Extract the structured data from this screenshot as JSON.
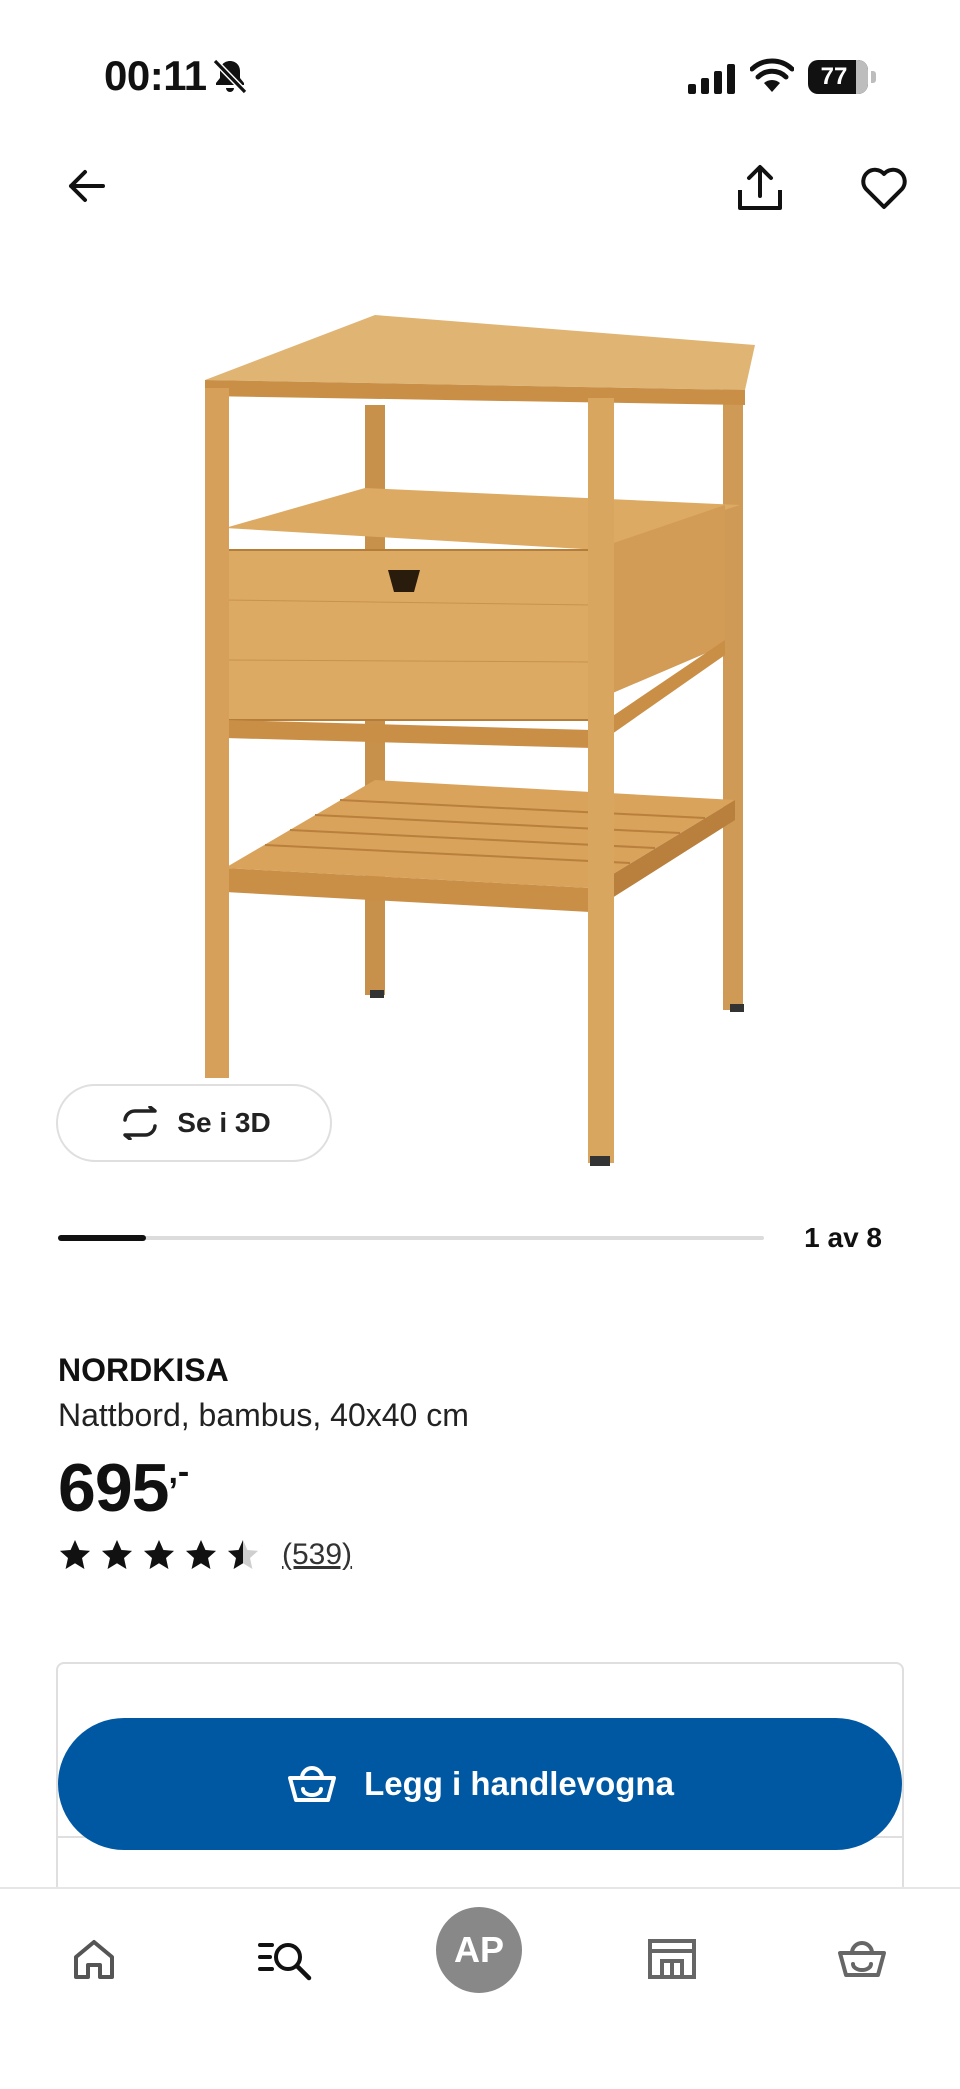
{
  "status_bar": {
    "time": "00:11",
    "battery": "77",
    "icons": [
      "bell-muted-icon",
      "signal-icon",
      "wifi-icon",
      "battery-icon"
    ]
  },
  "top_nav": {
    "icons": [
      "arrow-left-icon",
      "share-icon",
      "heart-icon"
    ]
  },
  "gallery": {
    "view_3d_label": "Se i 3D",
    "pager_text": "1 av 8",
    "current": 1,
    "total": 8
  },
  "product": {
    "name": "NORDKISA",
    "description": "Nattbord, bambus, 40x40 cm",
    "price": "695",
    "price_suffix": ",-",
    "rating": 4.5,
    "review_count": "(539)"
  },
  "cart_button": {
    "label": "Legg i handlevogna"
  },
  "bottom_nav": {
    "profile_initials": "AP",
    "items": [
      "home-icon",
      "search-list-icon",
      "profile-avatar",
      "store-icon",
      "cart-icon"
    ]
  },
  "colors": {
    "primary_blue": "#0058a3",
    "text": "#111111",
    "wood": "#d9a862",
    "avatar_gray": "#888888"
  }
}
